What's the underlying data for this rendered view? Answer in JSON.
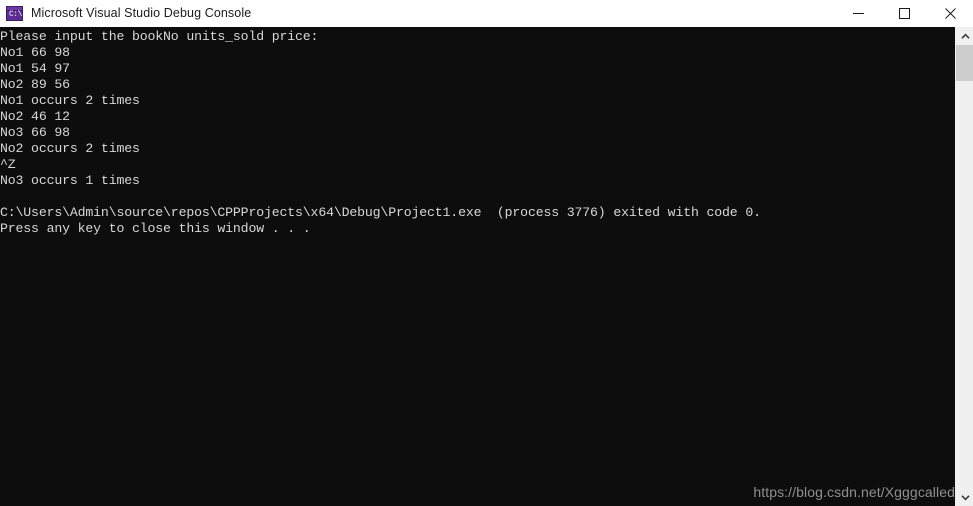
{
  "window": {
    "title": "Microsoft Visual Studio Debug Console",
    "icon_name": "console-app-icon",
    "icon_prompt_text": "C:\\",
    "icon_color": "#5c2d91"
  },
  "window_controls": {
    "minimize_label": "Minimize",
    "maximize_label": "Maximize",
    "close_label": "Close"
  },
  "console": {
    "background_color": "#0d0d0d",
    "text_color": "#d7d7d7",
    "lines": [
      "Please input the bookNo units_sold price:",
      "No1 66 98",
      "No1 54 97",
      "No2 89 56",
      "No1 occurs 2 times",
      "No2 46 12",
      "No3 66 98",
      "No2 occurs 2 times",
      "^Z",
      "No3 occurs 1 times",
      "",
      "C:\\Users\\Admin\\source\\repos\\CPPProjects\\x64\\Debug\\Project1.exe  (process 3776) exited with code 0.",
      "Press any key to close this window . . ."
    ]
  },
  "watermark": {
    "text": "https://blog.csdn.net/Xgggcalled",
    "color": "#8f8f8f"
  },
  "scrollbar": {
    "up_arrow_name": "chevron-up-icon",
    "down_arrow_name": "chevron-down-icon",
    "thumb_name": "scrollbar-thumb"
  }
}
